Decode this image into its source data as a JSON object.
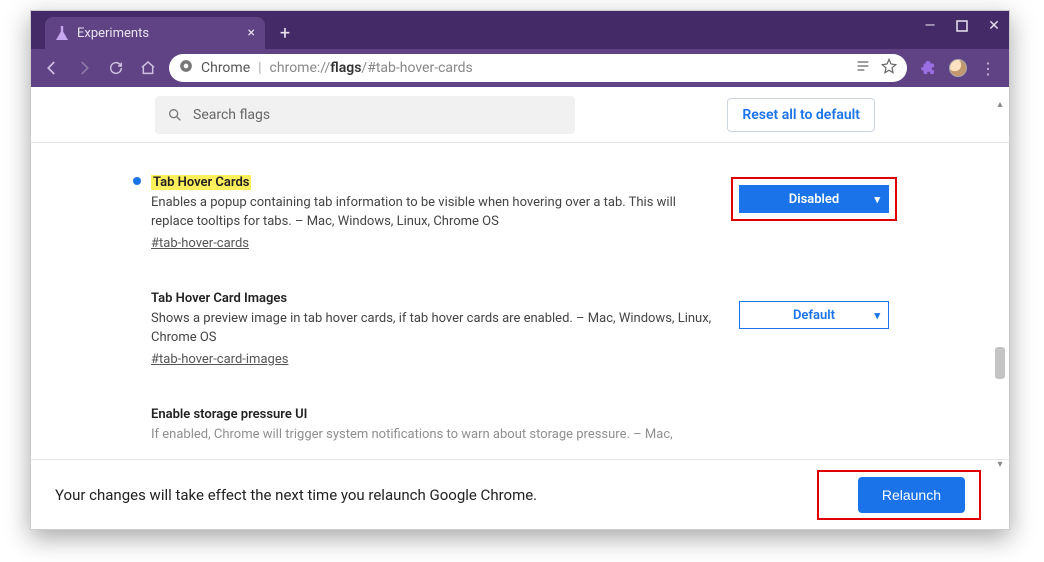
{
  "tab_title": "Experiments",
  "url_prefix": "Chrome",
  "url_path1": "chrome://",
  "url_path_bold": "flags",
  "url_path2": "/#tab-hover-cards",
  "search_placeholder": "Search flags",
  "reset_label": "Reset all to default",
  "flags": [
    {
      "title": "Tab Hover Cards",
      "highlight": true,
      "modified": true,
      "desc": "Enables a popup containing tab information to be visible when hovering over a tab. This will replace tooltips for tabs. – Mac, Windows, Linux, Chrome OS",
      "anchor": "#tab-hover-cards",
      "value": "Disabled",
      "active": true
    },
    {
      "title": "Tab Hover Card Images",
      "highlight": false,
      "modified": false,
      "desc": "Shows a preview image in tab hover cards, if tab hover cards are enabled. – Mac, Windows, Linux, Chrome OS",
      "anchor": "#tab-hover-card-images",
      "value": "Default",
      "active": false
    },
    {
      "title": "Enable storage pressure UI",
      "highlight": false,
      "modified": false,
      "desc": "If enabled, Chrome will trigger system notifications to warn about storage pressure. – Mac,",
      "anchor": "",
      "value": "",
      "active": false
    }
  ],
  "relaunch_msg": "Your changes will take effect the next time you relaunch Google Chrome.",
  "relaunch_label": "Relaunch"
}
